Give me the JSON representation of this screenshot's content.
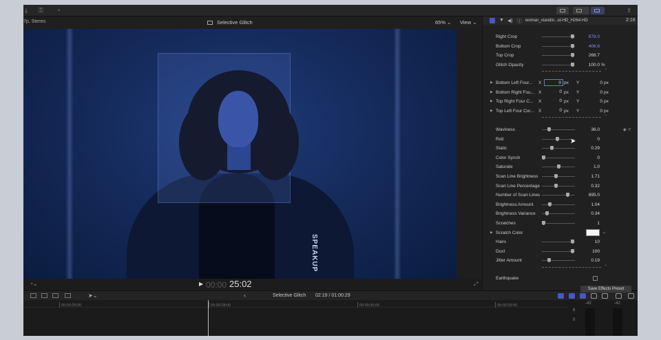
{
  "toolbar": {
    "left_icons": [
      "download-icon",
      "key-icon",
      "check-circle-icon"
    ],
    "right_icons": [
      "browser-layout-icon",
      "timeline-layout-icon",
      "inspector-layout-icon",
      "share-icon"
    ]
  },
  "viewer": {
    "format_label": "7p, Stereo",
    "clip_title": "Selective Glitch",
    "zoom": "65%",
    "view_menu": "View",
    "overlay_text": "SPEAKUP"
  },
  "playback": {
    "timecode_dim": "00:00",
    "timecode": "25:02"
  },
  "timeline_bar": {
    "clip_name": "Selective Glitch",
    "duration": "02:19 / 01:00:29"
  },
  "timeline": {
    "ruler": [
      "00:00:25:00",
      "00:00:28:00",
      "00:00:30:00",
      "00:00:33:00"
    ],
    "meter_labels": [
      "-42",
      "-42",
      "6",
      "0"
    ]
  },
  "inspector": {
    "clip_name": "woman_standin...id-HD_H264-HD",
    "duration": "2:16",
    "rows": [
      {
        "label": "Right Crop",
        "value": "878.0",
        "blue": true,
        "knob": 0.92
      },
      {
        "label": "Bottom Crop",
        "value": "406.8",
        "blue": true,
        "knob": 0.92
      },
      {
        "label": "Top Crop",
        "value": "268.7",
        "blue": false,
        "knob": 0.92
      },
      {
        "label": "Glitch Opacity",
        "value": "100.0",
        "unit": "%",
        "blue": false,
        "knob": 0.92
      }
    ],
    "corners": [
      {
        "label": "Bottom Left Four...",
        "x": "0",
        "y": "0"
      },
      {
        "label": "Bottom Right Fou...",
        "x": "0",
        "y": "0"
      },
      {
        "label": "Top Right Four C...",
        "x": "0",
        "y": "0"
      },
      {
        "label": "Top Left Four Cor...",
        "x": "0",
        "y": "0"
      }
    ],
    "unit_px": "px",
    "x_label": "X",
    "y_label": "Y",
    "params": [
      {
        "label": "Waviness",
        "value": "36.0",
        "knob": 0.2
      },
      {
        "label": "Roll",
        "value": "0",
        "knob": 0.45
      },
      {
        "label": "Static",
        "value": "0.29",
        "knob": 0.3
      },
      {
        "label": "Color Synch",
        "value": "0",
        "knob": 0.05
      },
      {
        "label": "Saturate",
        "value": "1.0",
        "knob": 0.5
      },
      {
        "label": "Scan Line Brightness",
        "value": "1.71",
        "knob": 0.42
      },
      {
        "label": "Scan Line Percentage",
        "value": "0.32",
        "knob": 0.42
      },
      {
        "label": "Number of Scan Lines",
        "value": "895.0",
        "knob": 0.78
      },
      {
        "label": "Brightness Amount",
        "value": "1.04",
        "knob": 0.22
      },
      {
        "label": "Brightness Variance",
        "value": "0.34",
        "knob": 0.15
      },
      {
        "label": "Scratches",
        "value": "1",
        "knob": 0.05
      }
    ],
    "scratch_color_label": "Scratch Color",
    "scratch_color": "#f4f4f4",
    "params2": [
      {
        "label": "Hairs",
        "value": "10",
        "knob": 0.92
      },
      {
        "label": "Dust",
        "value": "100",
        "knob": 0.92
      },
      {
        "label": "Jitter Amount",
        "value": "0.19",
        "knob": 0.2
      }
    ],
    "earthquake_label": "Earthquake",
    "save_preset": "Save Effects Preset"
  }
}
